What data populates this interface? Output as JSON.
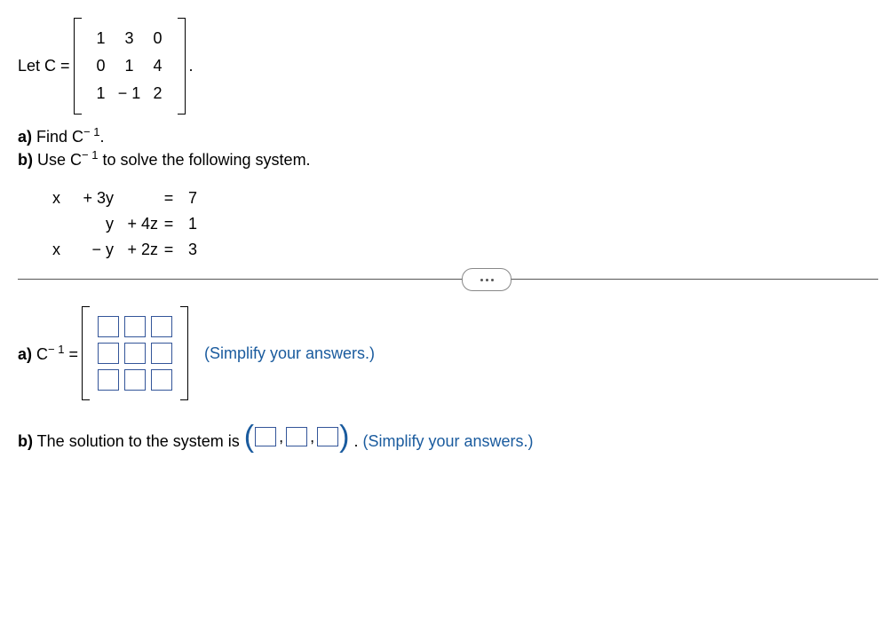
{
  "setup": {
    "prefix": "Let C =",
    "matrix": [
      [
        "1",
        "3",
        "0"
      ],
      [
        "0",
        "1",
        "4"
      ],
      [
        "1",
        "− 1",
        "2"
      ]
    ],
    "suffix": "."
  },
  "parts": {
    "a_label": "a)",
    "a_text": " Find C",
    "a_exp": "− 1",
    "a_end": ".",
    "b_label": "b)",
    "b_text": " Use C",
    "b_exp": "− 1",
    "b_end": " to solve the following system."
  },
  "equations": [
    {
      "x": "x",
      "y": "+ 3y",
      "z": "",
      "eq": "=",
      "rhs": "7"
    },
    {
      "x": "",
      "y": "y",
      "z": "+ 4z",
      "eq": "=",
      "rhs": "1"
    },
    {
      "x": "x",
      "y": "− y",
      "z": "+ 2z",
      "eq": "=",
      "rhs": "3"
    }
  ],
  "answers": {
    "a_label": "a)",
    "a_lhs": " C",
    "a_exp": "− 1",
    "a_eq": " = ",
    "hint": "(Simplify your answers.)",
    "b_label": "b)",
    "b_text": " The solution to the system is ",
    "b_period": ". "
  }
}
